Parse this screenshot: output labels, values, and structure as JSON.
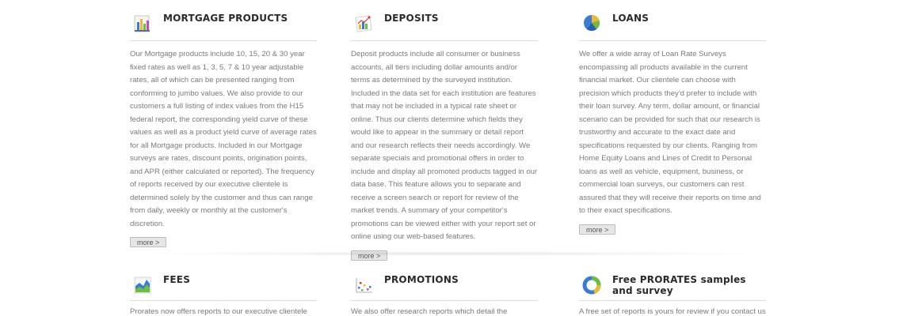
{
  "sections": {
    "mortgage": {
      "title": "MORTGAGE PRODUCTS",
      "icon": "bar-chart-icon",
      "text": "Our Mortgage products include 10, 15, 20 & 30 year fixed rates as well as 1, 3, 5, 7 & 10 year adjustable rates, all of which can be presented ranging from conforming to jumbo values. We also provide to our customers a full listing of index values from the H15 federal report, the corresponding yield curve of these values as well as a product yield curve of average rates for all Mortgage products. Included in our Mortgage surveys are rates, discount points, origination points, and APR (either calculated or reported). The frequency of reports received by our executive clientele is determined solely by the customer and thus can range from daily, weekly or monthly at the customer's discretion.",
      "more_label": "more >"
    },
    "deposits": {
      "title": "DEPOSITS",
      "icon": "line-chart-icon",
      "text": "Deposit products include all consumer or business accounts, all tiers including dollar amounts and/or terms as determined by the surveyed institution. Included in the data set for each institution are features that may not be included in a typical rate sheet or online. Thus our clients determine which fields they would like to appear in the summary or detail report and our research reflects their needs accordingly. We separate specials and promotional offers in order to include and display all promoted products tagged in our data base. This feature allows you to separate and receive a screen search or report for review of the market trends. A summary of your competitor's promotions can be viewed either with your report set or online using our web-based features.",
      "more_label": "more >"
    },
    "loans": {
      "title": "LOANS",
      "icon": "pie-chart-icon",
      "text": "We offer a wide array of Loan Rate Surveys encompassing all products available in the current financial market. Our clientele can choose with precision which products they'd prefer to include with their loan survey. Any term, dollar amount, or financial scenario can be provided for such that our research is trustworthy and accurate to the exact date and specifications requested by our clients. Ranging from Home Equity Loans and Lines of Credit to Personal loans as well as vehicle, equipment, business, or commercial loan surveys, our customers can rest assured that they will receive their reports on time and to their exact specifications.",
      "more_label": "more >"
    },
    "fees": {
      "title": "FEES",
      "icon": "area-chart-icon",
      "text": "Prorates now offers reports to our executive clientele"
    },
    "promotions": {
      "title": "PROMOTIONS",
      "icon": "scatter-chart-icon",
      "text": "We also offer research reports which detail the"
    },
    "samples": {
      "title": "Free PRORATES samples and survey",
      "icon": "donut-chart-icon",
      "text": "A free set of reports is yours for review if you contact us"
    }
  },
  "colors": {
    "heading": "#2a2a2a",
    "body_text": "#7a7a7a",
    "rule": "#dcdcdc"
  }
}
